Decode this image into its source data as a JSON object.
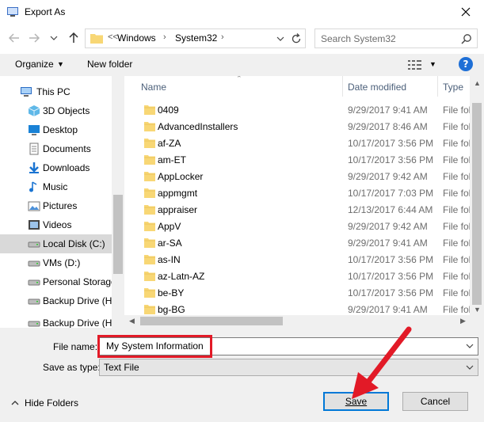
{
  "window": {
    "title": "Export As"
  },
  "address": {
    "overflow": "<<",
    "segments": [
      "Windows",
      "System32"
    ]
  },
  "search": {
    "placeholder": "Search System32"
  },
  "toolbar": {
    "organize": "Organize",
    "new_folder": "New folder",
    "help": "?"
  },
  "sidebar": {
    "items": [
      {
        "label": "This PC",
        "icon": "pc-icon"
      },
      {
        "label": "3D Objects",
        "icon": "cube-icon"
      },
      {
        "label": "Desktop",
        "icon": "desktop-icon"
      },
      {
        "label": "Documents",
        "icon": "documents-icon"
      },
      {
        "label": "Downloads",
        "icon": "downloads-icon"
      },
      {
        "label": "Music",
        "icon": "music-icon"
      },
      {
        "label": "Pictures",
        "icon": "pictures-icon"
      },
      {
        "label": "Videos",
        "icon": "videos-icon"
      },
      {
        "label": "Local Disk (C:)",
        "icon": "drive-icon"
      },
      {
        "label": "VMs (D:)",
        "icon": "drive-icon"
      },
      {
        "label": "Personal Storage",
        "icon": "drive-icon"
      },
      {
        "label": "Backup Drive (H",
        "icon": "drive-icon"
      },
      {
        "label": "Backup Drive (H:)",
        "icon": "drive-icon"
      }
    ],
    "selected_index": 8
  },
  "columns": {
    "name": "Name",
    "date": "Date modified",
    "type": "Type"
  },
  "files": [
    {
      "name": "0409",
      "date": "9/29/2017 9:41 AM",
      "type": "File fol"
    },
    {
      "name": "AdvancedInstallers",
      "date": "9/29/2017 8:46 AM",
      "type": "File fol"
    },
    {
      "name": "af-ZA",
      "date": "10/17/2017 3:56 PM",
      "type": "File fol"
    },
    {
      "name": "am-ET",
      "date": "10/17/2017 3:56 PM",
      "type": "File fol"
    },
    {
      "name": "AppLocker",
      "date": "9/29/2017 9:42 AM",
      "type": "File fol"
    },
    {
      "name": "appmgmt",
      "date": "10/17/2017 7:03 PM",
      "type": "File fol"
    },
    {
      "name": "appraiser",
      "date": "12/13/2017 6:44 AM",
      "type": "File fol"
    },
    {
      "name": "AppV",
      "date": "9/29/2017 9:42 AM",
      "type": "File fol"
    },
    {
      "name": "ar-SA",
      "date": "9/29/2017 9:41 AM",
      "type": "File fol"
    },
    {
      "name": "as-IN",
      "date": "10/17/2017 3:56 PM",
      "type": "File fol"
    },
    {
      "name": "az-Latn-AZ",
      "date": "10/17/2017 3:56 PM",
      "type": "File fol"
    },
    {
      "name": "be-BY",
      "date": "10/17/2017 3:56 PM",
      "type": "File fol"
    },
    {
      "name": "bg-BG",
      "date": "9/29/2017 9:41 AM",
      "type": "File fol"
    }
  ],
  "form": {
    "file_name_label": "File name:",
    "file_name_value": "My System Information",
    "save_type_label": "Save as type:",
    "save_type_value": "Text File"
  },
  "footer": {
    "hide_folders": "Hide Folders",
    "save": "Save",
    "cancel": "Cancel"
  },
  "colors": {
    "accent": "#0078d7",
    "highlight": "#e21a27",
    "folder": "#f8d775"
  }
}
